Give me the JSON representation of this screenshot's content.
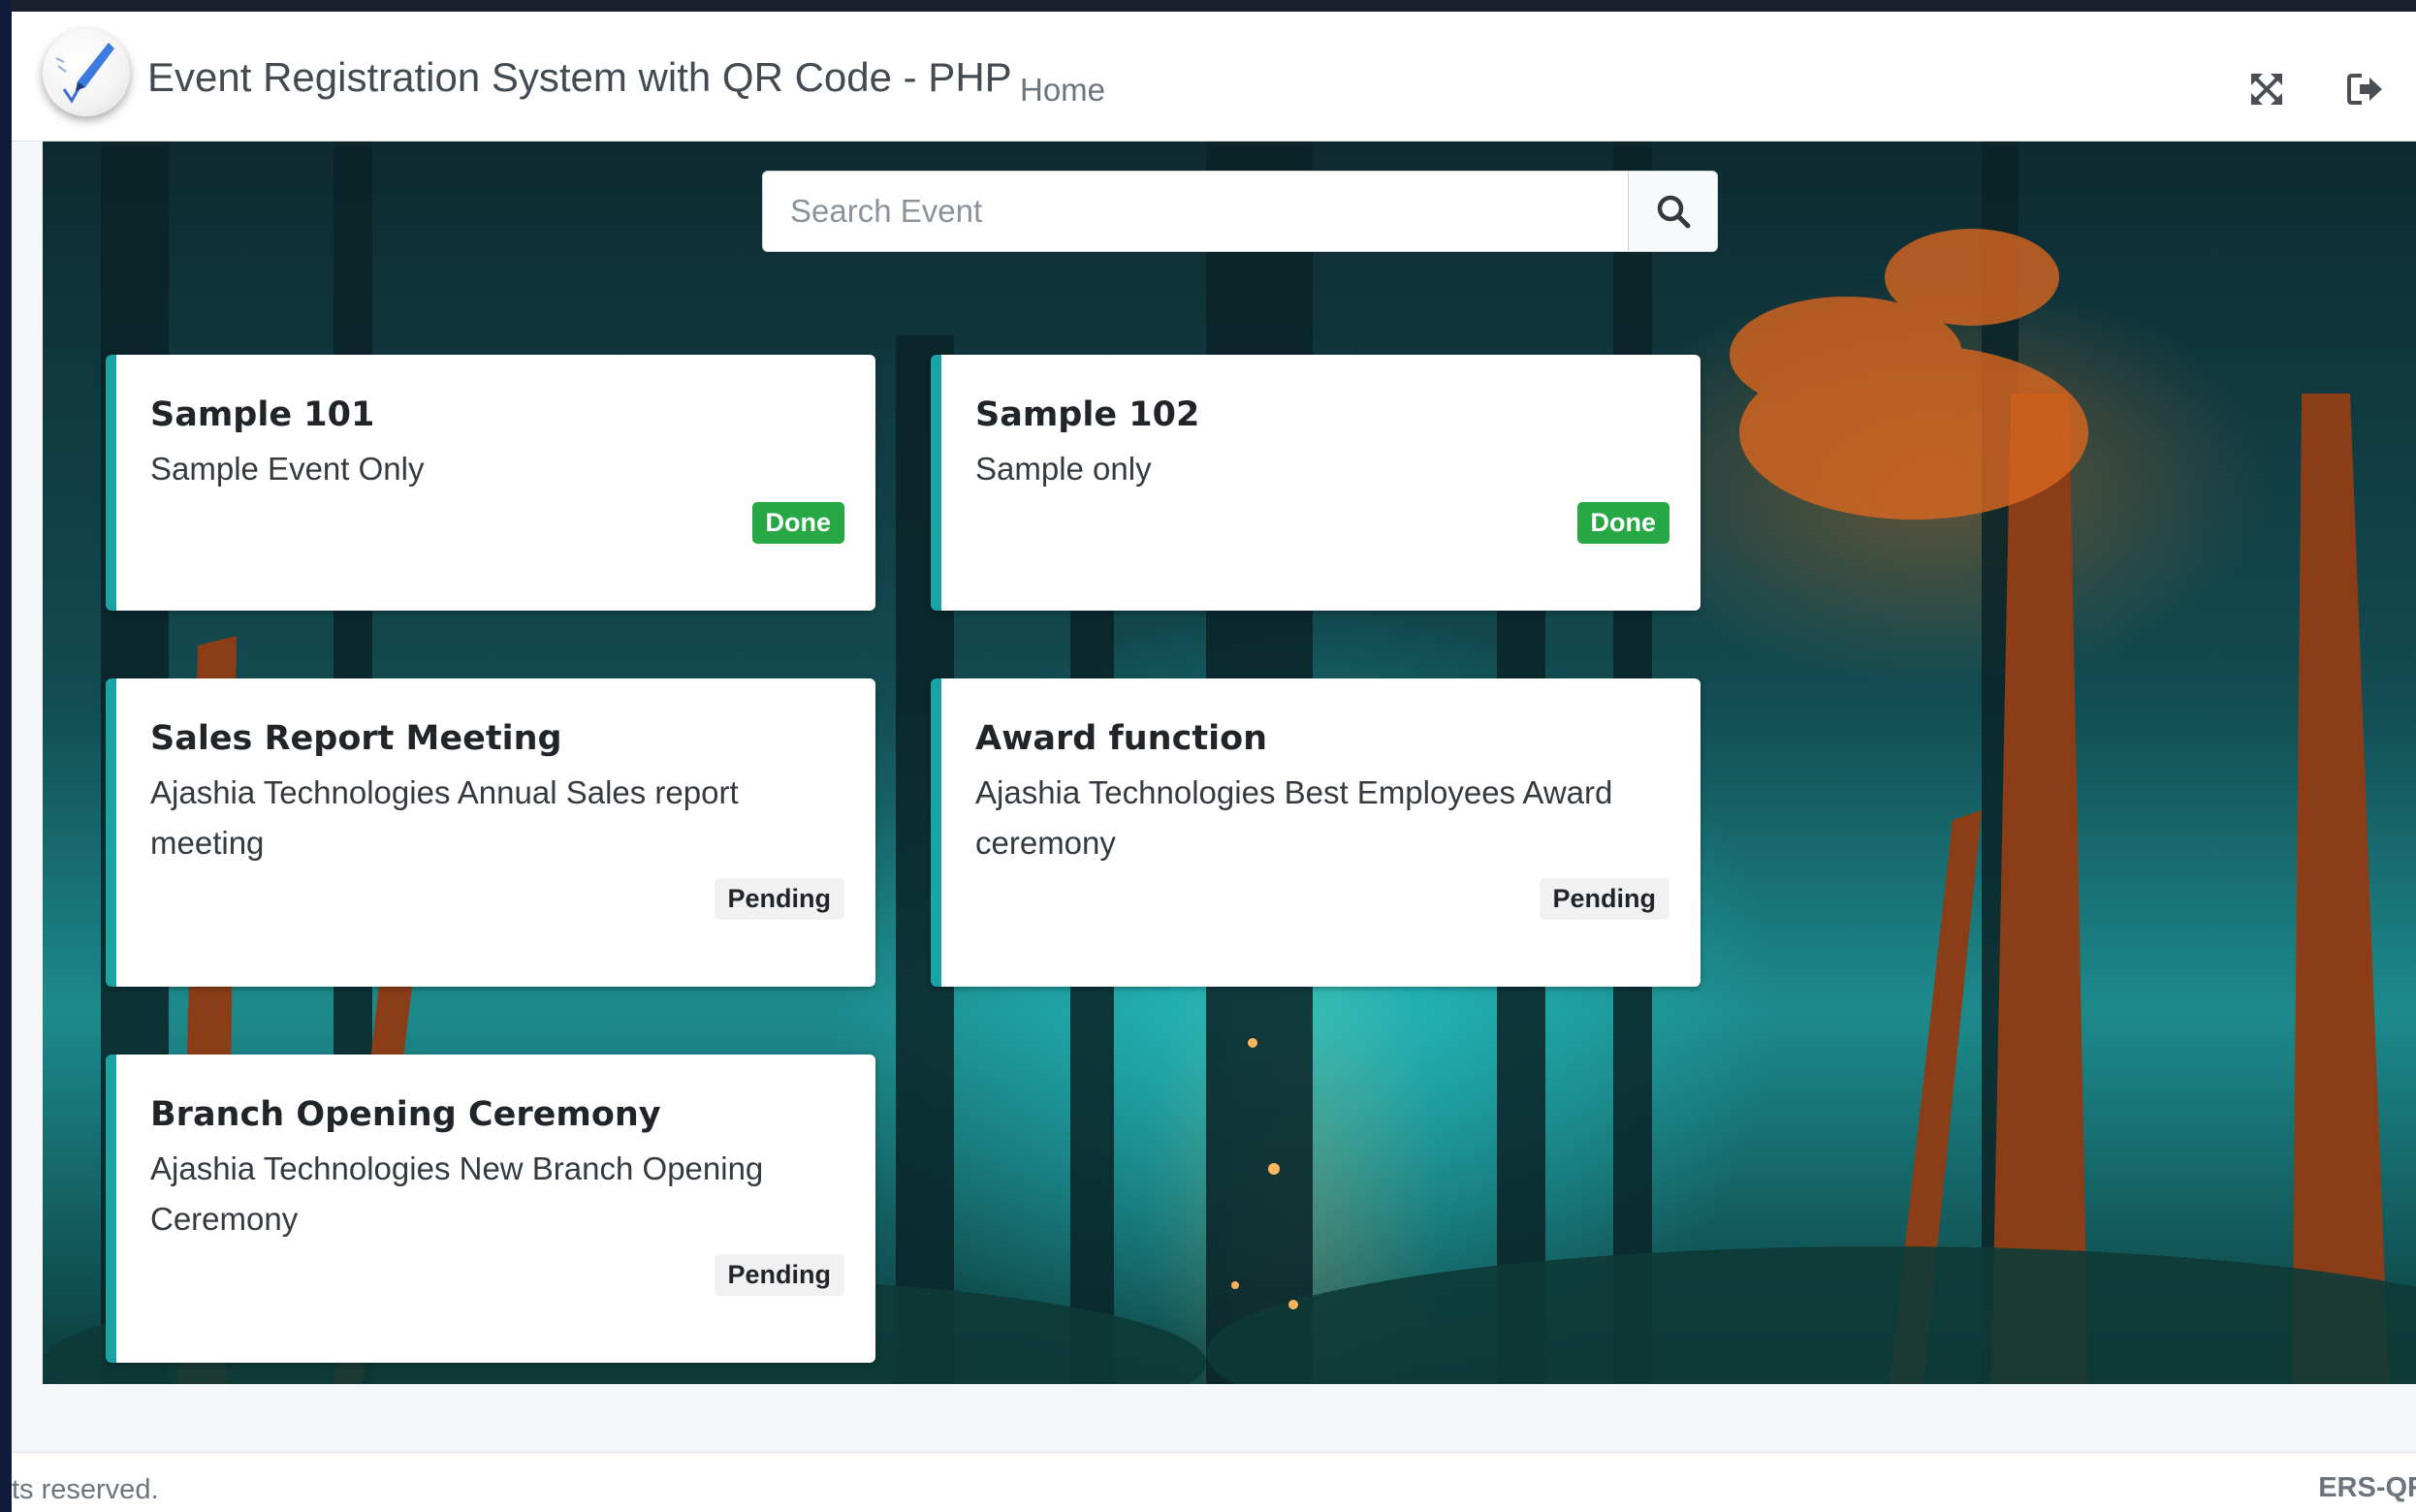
{
  "header": {
    "brand": "Event Registration System with QR Code - PHP",
    "nav_home": "Home",
    "icons": [
      "logo-icon",
      "fullscreen-icon",
      "logout-icon"
    ]
  },
  "search": {
    "placeholder": "Search Event",
    "icon": "search-icon"
  },
  "events": [
    {
      "title": "Sample 101",
      "description": "Sample Event Only",
      "status": "Done"
    },
    {
      "title": "Sample 102",
      "description": "Sample only",
      "status": "Done"
    },
    {
      "title": "Sales Report Meeting",
      "description": "Ajashia Technologies Annual Sales report meeting",
      "status": "Pending"
    },
    {
      "title": "Award function",
      "description": "Ajashia Technologies Best Employees Award ceremony",
      "status": "Pending"
    },
    {
      "title": "Branch Opening Ceremony",
      "description": "Ajashia Technologies New Branch Opening Ceremony",
      "status": "Pending"
    }
  ],
  "footer": {
    "left": "ts reserved.",
    "right": "ERS-QR"
  },
  "colors": {
    "card_accent": "#1aa3a3",
    "done_badge": "#28a745",
    "pending_badge": "#f1f1f1"
  }
}
